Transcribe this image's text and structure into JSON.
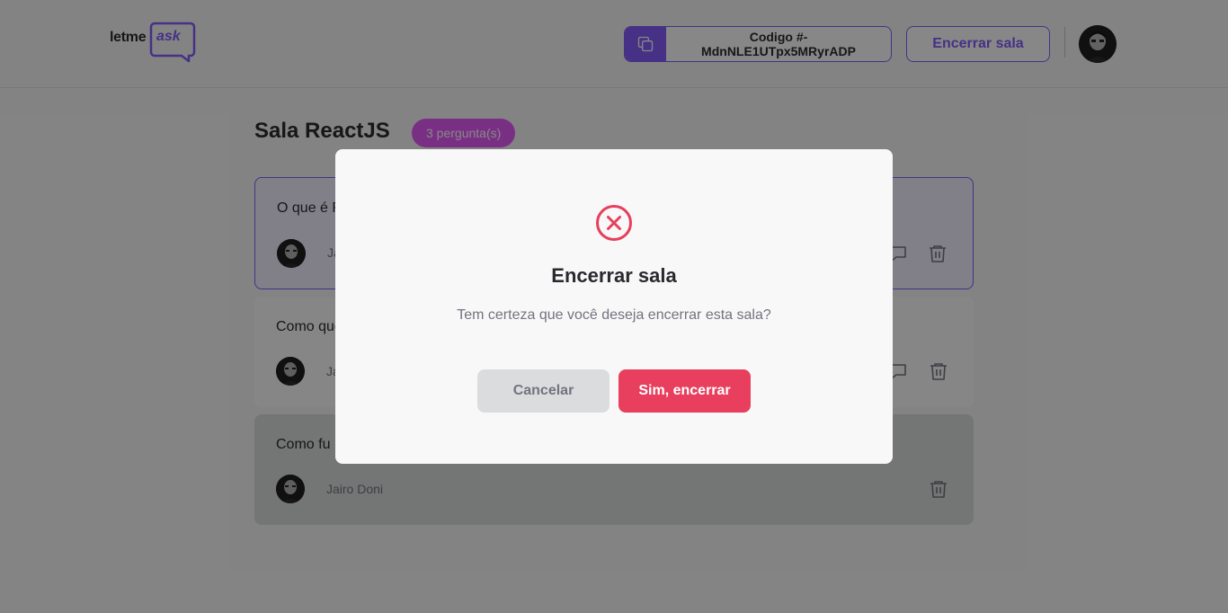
{
  "header": {
    "logo_prefix": "letme",
    "logo_suffix": "ask",
    "room_code": "Codigo #-MdnNLE1UTpx5MRyrADP",
    "close_room_label": "Encerrar sala",
    "copy_icon": "copy-icon",
    "avatar": "user-avatar"
  },
  "room": {
    "title": "Sala ReactJS",
    "question_count": "3 pergunta(s)"
  },
  "questions": [
    {
      "content": "O que é R",
      "author": "Ja",
      "state": "highlighted",
      "icons": [
        "chat-icon",
        "trash-icon"
      ]
    },
    {
      "content": "Como que",
      "author": "Ja",
      "state": "normal",
      "icons": [
        "chat-icon",
        "trash-icon"
      ]
    },
    {
      "content": "Como fu",
      "author": "Jairo Doni",
      "state": "answered",
      "icons": [
        "trash-icon"
      ]
    }
  ],
  "modal": {
    "icon": "x-circle-icon",
    "title": "Encerrar sala",
    "message": "Tem certeza que você deseja encerrar esta sala?",
    "cancel_label": "Cancelar",
    "confirm_label": "Sim, encerrar"
  },
  "colors": {
    "brand": "#835afd",
    "badge": "#e559f9",
    "danger": "#e73f5d",
    "text_dark": "#29292e",
    "text_muted": "#737380"
  }
}
